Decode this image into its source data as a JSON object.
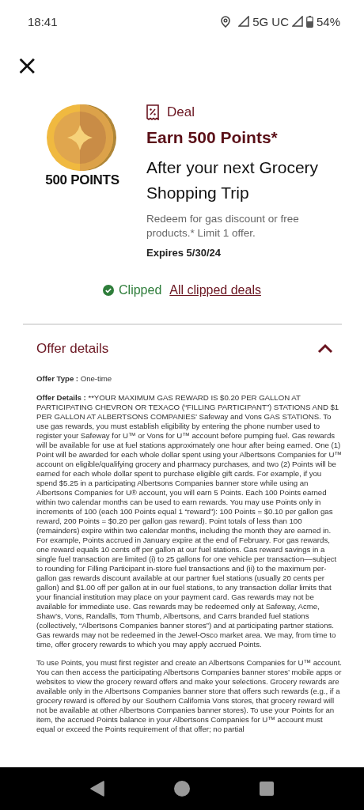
{
  "status_bar": {
    "time": "18:41",
    "network": "5G UC",
    "battery": "54%"
  },
  "close_button": {
    "label": "×"
  },
  "deal": {
    "coin_label": "500 POINTS",
    "badge": "Deal",
    "title": "Earn 500 Points*",
    "subtitle": "After your next Grocery Shopping Trip",
    "description": "Redeem for gas discount or free products.* Limit 1 offer.",
    "expires": "Expires 5/30/24",
    "clipped": true,
    "clipped_label": "Clipped",
    "clipped_link": "All clipped deals"
  },
  "offer_details": {
    "title": "Offer details",
    "expanded": true,
    "paragraphs": [
      "**Offer Type :** One-time",
      "**Offer Details :** **YOUR MAXIMUM GAS REWARD IS $0.20 PER GALLON AT PARTICIPATING CHEVRON OR TEXACO (“FILLING PARTICIPANT”) STATIONS AND $1 PER GALLON AT ALBERTSONS COMPANIES’ Safeway and Vons GAS STATIONS. To use gas rewards, you must establish eligibility by entering the phone number used to register your Safeway for U™ or Vons for U™ account before pumping fuel. Gas rewards will be available for use at fuel stations approximately one hour after being earned. One (1) Point will be awarded for each whole dollar spent using your Albertsons Companies for U™ account on eligible/qualifying grocery and pharmacy purchases, and two (2) Points will be earned for each whole dollar spent to purchase eligible gift cards. For example, if you spend $5.25 in a participating Albertsons Companies banner store while using an Albertsons Companies for U® account, you will earn 5 Points. Each 100 Points earned within two calendar months can be used to earn rewards. You may use Points only in increments of 100 (each 100 Points equal 1 “reward”): 100 Points = $0.10 per gallon gas reward, 200 Points = $0.20 per gallon gas reward). Point totals of less than 100 (remainders) expire within two calendar months, including the month they are earned in. For example, Points accrued in January expire at the end of February. For gas rewards, one reward equals 10 cents off per gallon at our fuel stations. Gas reward savings in a single fuel transaction are limited (i) to 25 gallons for one vehicle per transaction––subject to rounding for Filling Participant in-store fuel transactions and (ii) to the maximum per-gallon gas rewards discount available at our partner fuel stations (usually 20 cents per gallon) and $1.00 off per gallon at in our fuel stations, to any transaction dollar limits that your financial institution may place on your payment card. Gas rewards may not be available for immediate use. Gas rewards may be redeemed only at Safeway, Acme, Shaw’s, Vons, Randalls, Tom Thumb, Albertsons, and Carrs branded fuel stations (collectively, “Albertsons Companies banner stores”) and at participating partner stations. Gas rewards may not be redeemed in the Jewel-Osco market area. We may, from time to time, offer grocery rewards to which you may apply accrued Points.",
      "To use Points, you must first register and create an Albertsons Companies for U™ account. You can then access the participating Albertsons Companies banner stores’ mobile apps or websites to view the grocery reward offers and make your selections. Grocery rewards are available only in the Albertsons Companies banner store that offers such rewards (e.g., if a grocery reward is offered by our Southern California Vons stores, that grocery reward will not be available at other Albertsons Companies banner stores). To use your Points for an item, the accrued Points balance in your Albertsons Companies for U™ account must equal or exceed the Points requirement of that offer; no partial"
    ]
  }
}
